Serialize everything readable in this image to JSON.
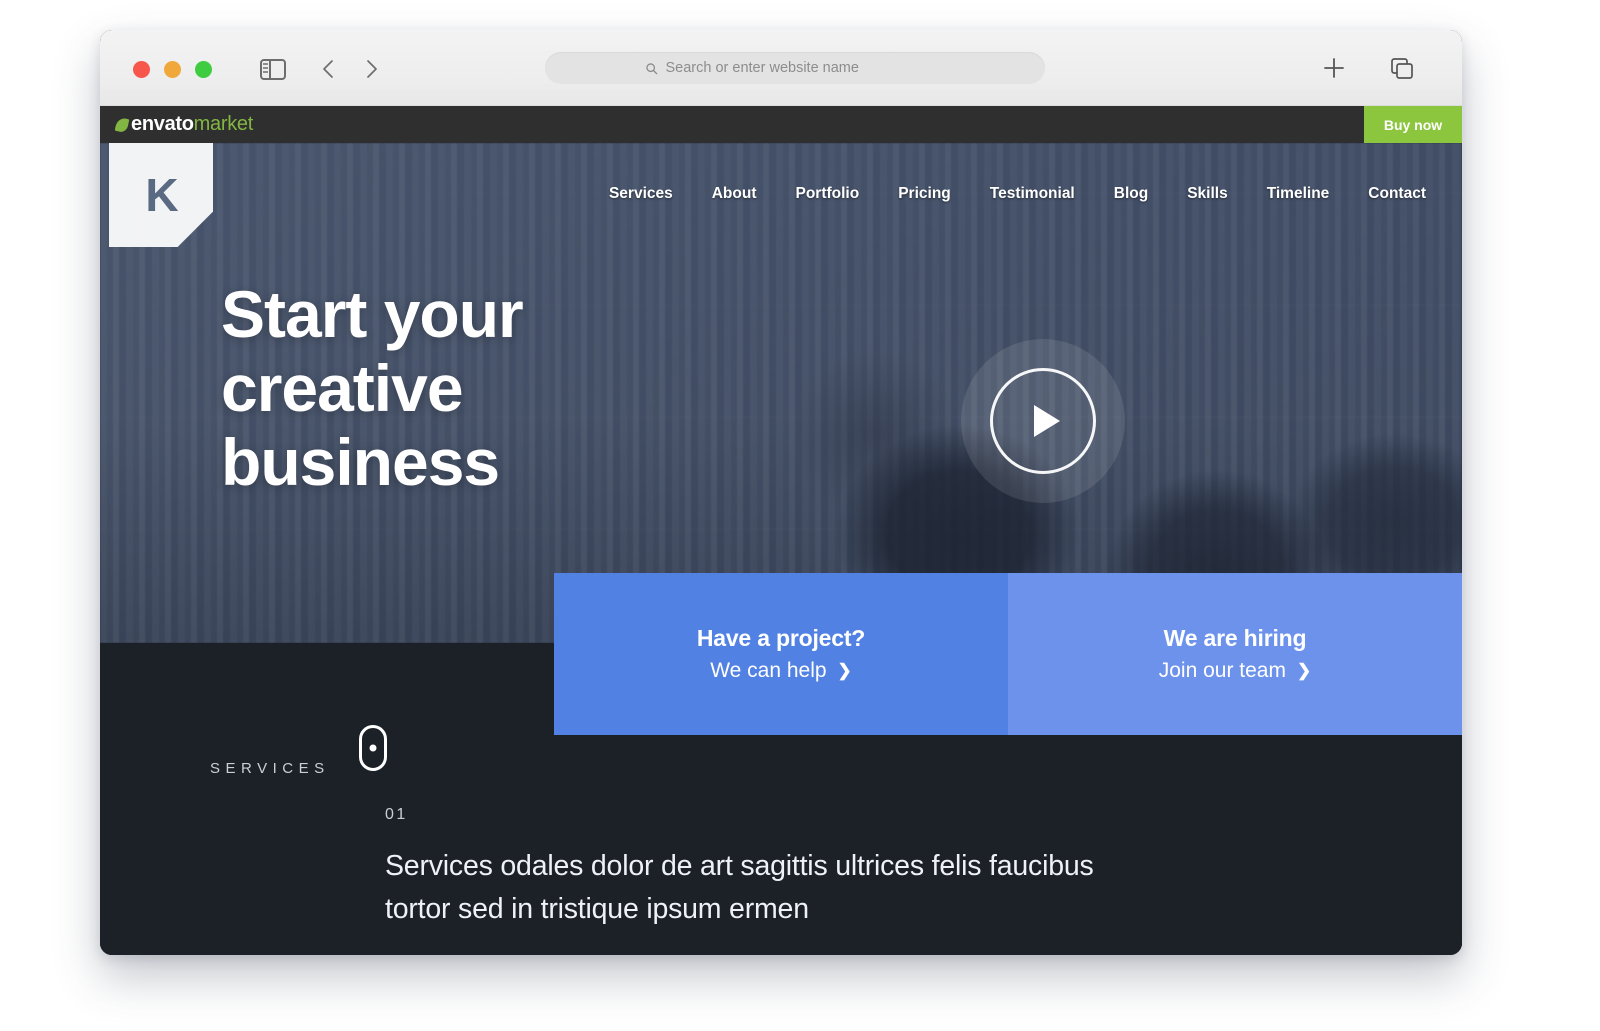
{
  "browser": {
    "traffic_lights": [
      "close",
      "minimize",
      "zoom"
    ],
    "sidebar_toggle_icon": "sidebar-icon",
    "back_icon": "chevron-left-icon",
    "forward_icon": "chevron-right-icon",
    "search": {
      "icon": "search-icon",
      "value": "",
      "placeholder": "Search or enter website name"
    },
    "new_tab_icon": "plus-icon",
    "tab_overview_icon": "tab-overview-icon"
  },
  "envato_bar": {
    "leaf_icon": "leaf-icon",
    "brand_primary": "envato",
    "brand_secondary": "market",
    "buy_now_label": "Buy now",
    "brand_green": "#82b541",
    "button_green": "#8cc63e",
    "bar_background": "#2f2f2f"
  },
  "site": {
    "logo": {
      "letter": "K",
      "name": "k-logo"
    },
    "nav": [
      {
        "label": "Services"
      },
      {
        "label": "About"
      },
      {
        "label": "Portfolio"
      },
      {
        "label": "Pricing"
      },
      {
        "label": "Testimonial"
      },
      {
        "label": "Blog"
      },
      {
        "label": "Skills"
      },
      {
        "label": "Timeline"
      },
      {
        "label": "Contact"
      }
    ],
    "hero": {
      "heading_line1": "Start your",
      "heading_line2": "creative",
      "heading_line3": "business",
      "play_icon": "play-icon",
      "scroll_icon": "mouse-scroll-icon"
    },
    "cta": [
      {
        "title": "Have a project?",
        "link_label": "We can help",
        "arrow": "❯",
        "color": "#5281e4"
      },
      {
        "title": "We are hiring",
        "link_label": "Join our team",
        "arrow": "❯",
        "color": "#6c92ec"
      }
    ],
    "services": {
      "kicker": "SERVICES",
      "number": "01",
      "headline": "Services odales dolor de art sagittis ultrices felis faucibus tortor sed in tristique ipsum ermen",
      "background": "#1c2027"
    }
  }
}
